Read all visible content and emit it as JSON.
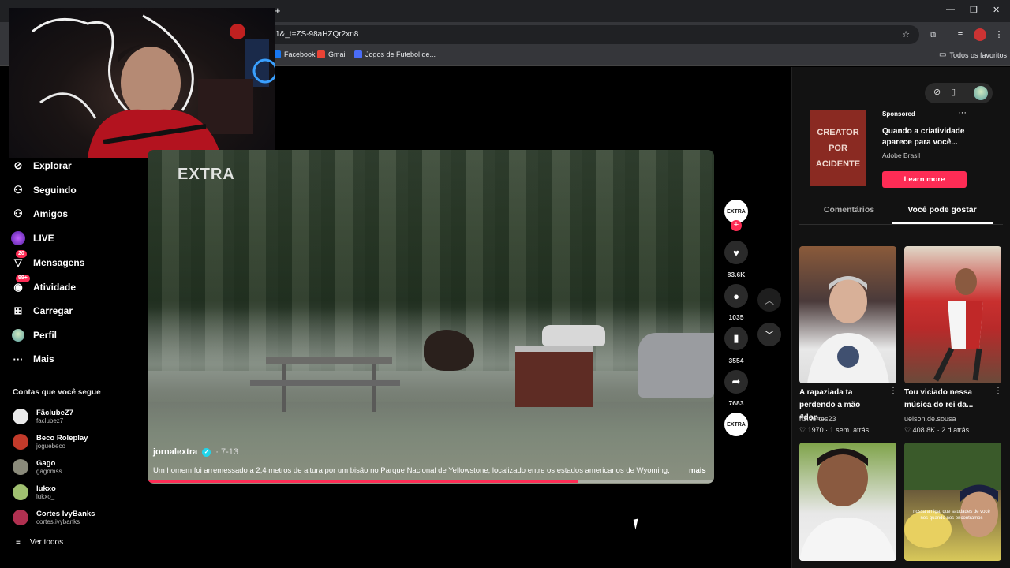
{
  "browser": {
    "url": "1&_t=ZS-98aHZQr2xn8",
    "bookmarks": [
      {
        "label": "Facebook",
        "color": "#1877f2"
      },
      {
        "label": "Gmail",
        "color": "#ea4335"
      },
      {
        "label": "Jogos de Futebol de...",
        "color": "#4a6cf7"
      }
    ],
    "favorites_label": "Todos os favoritos",
    "new_tab": "+"
  },
  "sidebar": {
    "items": [
      {
        "label": "Explorar",
        "icon": "compass-icon",
        "glyph": "⊘"
      },
      {
        "label": "Seguindo",
        "icon": "user-follow-icon",
        "glyph": "⚇"
      },
      {
        "label": "Amigos",
        "icon": "friends-icon",
        "glyph": "⚇"
      },
      {
        "label": "LIVE",
        "icon": "live-icon",
        "glyph": "●"
      },
      {
        "label": "Mensagens",
        "icon": "message-icon",
        "glyph": "▽",
        "badge": "20"
      },
      {
        "label": "Atividade",
        "icon": "activity-icon",
        "glyph": "◉",
        "badge": "99+"
      },
      {
        "label": "Carregar",
        "icon": "upload-icon",
        "glyph": "⊞"
      },
      {
        "label": "Perfil",
        "icon": "profile-avatar-icon",
        "glyph": "●"
      },
      {
        "label": "Mais",
        "icon": "more-icon",
        "glyph": "···"
      }
    ],
    "following_title": "Contas que você segue",
    "accounts": [
      {
        "name": "FãclubeZ7",
        "handle": "faclubez7",
        "color": "#e9e9e9"
      },
      {
        "name": "Beco Roleplay",
        "handle": "joguebeco",
        "color": "#c23a2a"
      },
      {
        "name": "Gago",
        "handle": "gagomss",
        "color": "#8a8a7a"
      },
      {
        "name": "lukxo",
        "handle": "lukxo_",
        "color": "#a0c070"
      },
      {
        "name": "Cortes IvyBanks",
        "handle": "cortes.ivybanks",
        "color": "#b03050"
      }
    ],
    "see_all": "Ver todos"
  },
  "video": {
    "logo": "EXTRA",
    "author": "jornalextra",
    "date": "· 7-13",
    "caption": "Um homem foi arremessado a 2,4 metros de altura por um bisão no Parque Nacional de Yellowstone, localizado entre os estados americanos de Wyoming,",
    "more": "mais",
    "progress": 0.76
  },
  "actions": {
    "avatar_label": "EXTRA",
    "likes": "83.6K",
    "comments": "1035",
    "saves": "3554",
    "shares": "7683"
  },
  "right_panel": {
    "ad": {
      "image_lines": [
        "CREATOR",
        "POR",
        "ACIDENTE"
      ],
      "sponsored": "Sponsored",
      "title": "Quando a criatividade aparece para você...",
      "brand": "Adobe Brasil",
      "cta": "Learn more"
    },
    "tabs": {
      "comments": "Comentários",
      "recommended": "Você pode gostar"
    },
    "thumbs": [
      {
        "title": "A rapaziada ta perdendo a mão #don...",
        "author": "hz.cortes23",
        "likes": "1970",
        "time": "1 sem. atrás",
        "bg": "#6a4a3a"
      },
      {
        "title": "Tou viciado nessa música do rei da...",
        "author": "uelson.de.sousa",
        "likes": "408.8K",
        "time": "2 d atrás",
        "bg": "#c9302f"
      },
      {
        "title": "",
        "author": "",
        "likes": "",
        "time": "",
        "bg": "#7fa34a"
      },
      {
        "title": "",
        "author": "",
        "likes": "",
        "time": "",
        "bg": "#5a4a3a"
      }
    ],
    "thumb4_overlay": "nossa amiga, que saudades de você nos quando nos encontramos"
  }
}
